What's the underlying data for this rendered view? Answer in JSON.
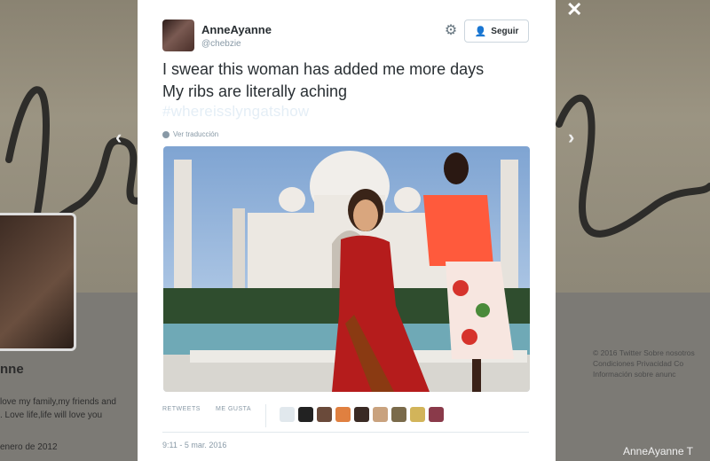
{
  "background": {
    "profile_name": "nne",
    "bio": "love my family,my friends and\n. Love life,life will love you",
    "joined": "enero de 2012",
    "footer": "© 2016 Twitter  Sobre nosotros\nCondiciones  Privacidad  Co\nInformación sobre anunc",
    "watermark": "AnneAyanne T"
  },
  "modal": {
    "close_label": "✕",
    "prev_label": "‹",
    "next_label": "›"
  },
  "tweet": {
    "author_name": "AnneAyanne",
    "author_handle": "@chebzie",
    "follow_label": "Seguir",
    "text_line1": "I swear this woman has added me more days",
    "text_line2": "My ribs are literally aching",
    "hashtag": "#whereisslyngatshow",
    "translate_label": "Ver traducción",
    "retweets_label": "RETWEETS",
    "retweets_value": "",
    "likes_label": "ME GUSTA",
    "likes_value": "",
    "timestamp": "9:11 - 5 mar. 2016"
  },
  "colors": {
    "accent": "#55acee",
    "text": "#292f33",
    "muted": "#8899a6"
  },
  "icons": {
    "settings": "gear-icon",
    "follow": "add-user-icon",
    "translate": "globe-icon",
    "close": "close-icon"
  }
}
